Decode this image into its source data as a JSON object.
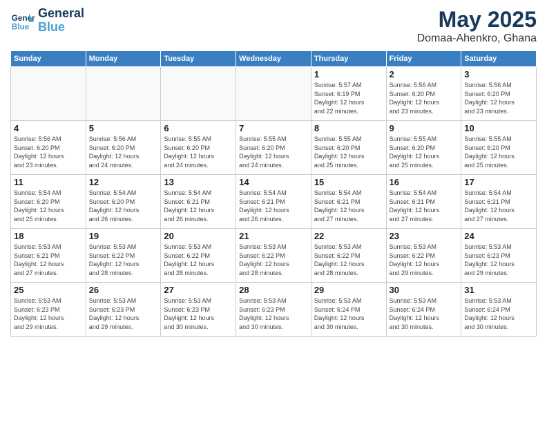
{
  "logo": {
    "line1": "General",
    "line2": "Blue"
  },
  "title": "May 2025",
  "location": "Domaa-Ahenkro, Ghana",
  "headers": [
    "Sunday",
    "Monday",
    "Tuesday",
    "Wednesday",
    "Thursday",
    "Friday",
    "Saturday"
  ],
  "weeks": [
    [
      {
        "day": "",
        "info": ""
      },
      {
        "day": "",
        "info": ""
      },
      {
        "day": "",
        "info": ""
      },
      {
        "day": "",
        "info": ""
      },
      {
        "day": "1",
        "info": "Sunrise: 5:57 AM\nSunset: 6:19 PM\nDaylight: 12 hours\nand 22 minutes."
      },
      {
        "day": "2",
        "info": "Sunrise: 5:56 AM\nSunset: 6:20 PM\nDaylight: 12 hours\nand 23 minutes."
      },
      {
        "day": "3",
        "info": "Sunrise: 5:56 AM\nSunset: 6:20 PM\nDaylight: 12 hours\nand 23 minutes."
      }
    ],
    [
      {
        "day": "4",
        "info": "Sunrise: 5:56 AM\nSunset: 6:20 PM\nDaylight: 12 hours\nand 23 minutes."
      },
      {
        "day": "5",
        "info": "Sunrise: 5:56 AM\nSunset: 6:20 PM\nDaylight: 12 hours\nand 24 minutes."
      },
      {
        "day": "6",
        "info": "Sunrise: 5:55 AM\nSunset: 6:20 PM\nDaylight: 12 hours\nand 24 minutes."
      },
      {
        "day": "7",
        "info": "Sunrise: 5:55 AM\nSunset: 6:20 PM\nDaylight: 12 hours\nand 24 minutes."
      },
      {
        "day": "8",
        "info": "Sunrise: 5:55 AM\nSunset: 6:20 PM\nDaylight: 12 hours\nand 25 minutes."
      },
      {
        "day": "9",
        "info": "Sunrise: 5:55 AM\nSunset: 6:20 PM\nDaylight: 12 hours\nand 25 minutes."
      },
      {
        "day": "10",
        "info": "Sunrise: 5:55 AM\nSunset: 6:20 PM\nDaylight: 12 hours\nand 25 minutes."
      }
    ],
    [
      {
        "day": "11",
        "info": "Sunrise: 5:54 AM\nSunset: 6:20 PM\nDaylight: 12 hours\nand 25 minutes."
      },
      {
        "day": "12",
        "info": "Sunrise: 5:54 AM\nSunset: 6:20 PM\nDaylight: 12 hours\nand 26 minutes."
      },
      {
        "day": "13",
        "info": "Sunrise: 5:54 AM\nSunset: 6:21 PM\nDaylight: 12 hours\nand 26 minutes."
      },
      {
        "day": "14",
        "info": "Sunrise: 5:54 AM\nSunset: 6:21 PM\nDaylight: 12 hours\nand 26 minutes."
      },
      {
        "day": "15",
        "info": "Sunrise: 5:54 AM\nSunset: 6:21 PM\nDaylight: 12 hours\nand 27 minutes."
      },
      {
        "day": "16",
        "info": "Sunrise: 5:54 AM\nSunset: 6:21 PM\nDaylight: 12 hours\nand 27 minutes."
      },
      {
        "day": "17",
        "info": "Sunrise: 5:54 AM\nSunset: 6:21 PM\nDaylight: 12 hours\nand 27 minutes."
      }
    ],
    [
      {
        "day": "18",
        "info": "Sunrise: 5:53 AM\nSunset: 6:21 PM\nDaylight: 12 hours\nand 27 minutes."
      },
      {
        "day": "19",
        "info": "Sunrise: 5:53 AM\nSunset: 6:22 PM\nDaylight: 12 hours\nand 28 minutes."
      },
      {
        "day": "20",
        "info": "Sunrise: 5:53 AM\nSunset: 6:22 PM\nDaylight: 12 hours\nand 28 minutes."
      },
      {
        "day": "21",
        "info": "Sunrise: 5:53 AM\nSunset: 6:22 PM\nDaylight: 12 hours\nand 28 minutes."
      },
      {
        "day": "22",
        "info": "Sunrise: 5:53 AM\nSunset: 6:22 PM\nDaylight: 12 hours\nand 28 minutes."
      },
      {
        "day": "23",
        "info": "Sunrise: 5:53 AM\nSunset: 6:22 PM\nDaylight: 12 hours\nand 29 minutes."
      },
      {
        "day": "24",
        "info": "Sunrise: 5:53 AM\nSunset: 6:23 PM\nDaylight: 12 hours\nand 29 minutes."
      }
    ],
    [
      {
        "day": "25",
        "info": "Sunrise: 5:53 AM\nSunset: 6:23 PM\nDaylight: 12 hours\nand 29 minutes."
      },
      {
        "day": "26",
        "info": "Sunrise: 5:53 AM\nSunset: 6:23 PM\nDaylight: 12 hours\nand 29 minutes."
      },
      {
        "day": "27",
        "info": "Sunrise: 5:53 AM\nSunset: 6:23 PM\nDaylight: 12 hours\nand 30 minutes."
      },
      {
        "day": "28",
        "info": "Sunrise: 5:53 AM\nSunset: 6:23 PM\nDaylight: 12 hours\nand 30 minutes."
      },
      {
        "day": "29",
        "info": "Sunrise: 5:53 AM\nSunset: 6:24 PM\nDaylight: 12 hours\nand 30 minutes."
      },
      {
        "day": "30",
        "info": "Sunrise: 5:53 AM\nSunset: 6:24 PM\nDaylight: 12 hours\nand 30 minutes."
      },
      {
        "day": "31",
        "info": "Sunrise: 5:53 AM\nSunset: 6:24 PM\nDaylight: 12 hours\nand 30 minutes."
      }
    ]
  ]
}
